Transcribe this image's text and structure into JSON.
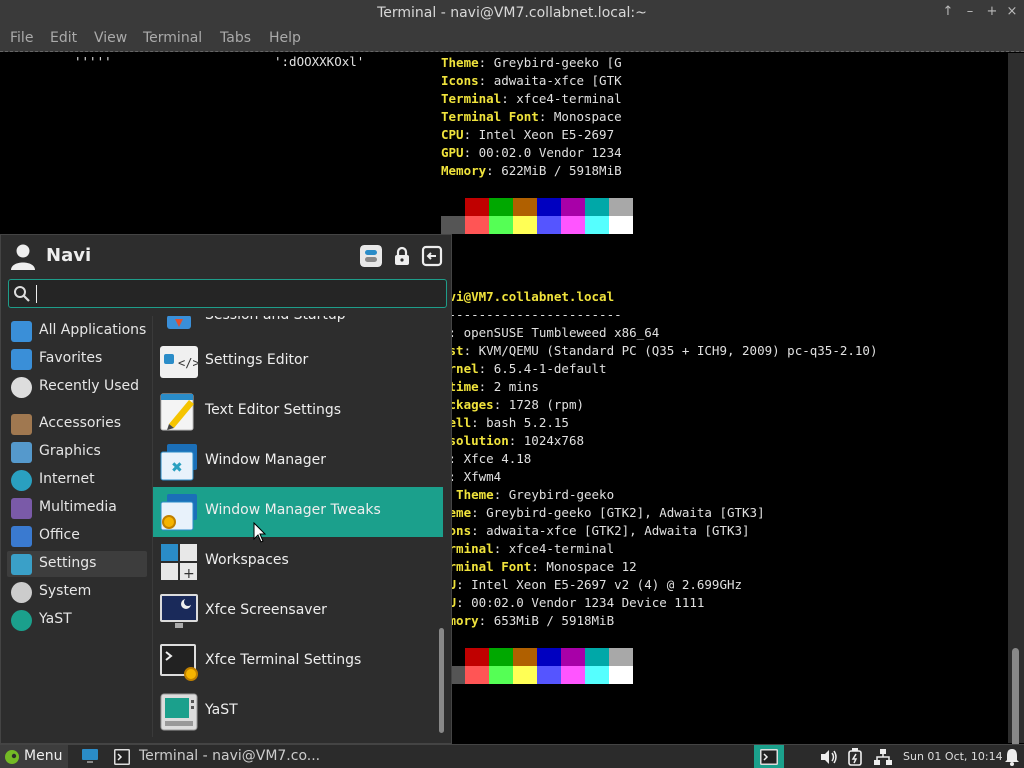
{
  "window": {
    "title": "Terminal - navi@VM7.collabnet.local:~",
    "controls": [
      "↑",
      "–",
      "+",
      "×"
    ]
  },
  "menubar": [
    "File",
    "Edit",
    "View",
    "Terminal",
    "Tabs",
    "Help"
  ],
  "terminal": {
    "top": {
      "logo_left": "'''''",
      "logo_right": "':dOOXXKOxl'",
      "rows": [
        {
          "k": "Theme",
          "v": ": Greybird-geeko [G"
        },
        {
          "k": "Icons",
          "v": ": adwaita-xfce [GTK"
        },
        {
          "k": "Terminal",
          "v": ": xfce4-terminal"
        },
        {
          "k": "Terminal Font",
          "v": ": Monospace"
        },
        {
          "k": "CPU",
          "v": ": Intel Xeon E5-2697"
        },
        {
          "k": "GPU",
          "v": ": 00:02.0 Vendor 1234"
        },
        {
          "k": "Memory",
          "v": ": 622MiB / 5918MiB"
        }
      ]
    },
    "bottom": {
      "user_host": "avi@VM7.collabnet.local",
      "divider": "------------------------",
      "rows": [
        {
          "k": "S",
          "v": ": openSUSE Tumbleweed x86_64"
        },
        {
          "k": "ost",
          "v": ": KVM/QEMU (Standard PC (Q35 + ICH9, 2009) pc-q35-2.10)"
        },
        {
          "k": "ernel",
          "v": ": 6.5.4-1-default"
        },
        {
          "k": "ptime",
          "v": ": 2 mins"
        },
        {
          "k": "ackages",
          "v": ": 1728 (rpm)"
        },
        {
          "k": "hell",
          "v": ": bash 5.2.15"
        },
        {
          "k": "esolution",
          "v": ": 1024x768"
        },
        {
          "k": "E",
          "v": ": Xfce 4.18"
        },
        {
          "k": "M",
          "v": ": Xfwm4"
        },
        {
          "k": "M Theme",
          "v": ": Greybird-geeko"
        },
        {
          "k": "heme",
          "v": ": Greybird-geeko [GTK2], Adwaita [GTK3]"
        },
        {
          "k": "cons",
          "v": ": adwaita-xfce [GTK2], Adwaita [GTK3]"
        },
        {
          "k": "erminal",
          "v": ": xfce4-terminal"
        },
        {
          "k": "erminal Font",
          "v": ": Monospace 12"
        },
        {
          "k": "PU",
          "v": ": Intel Xeon E5-2697 v2 (4) @ 2.699GHz"
        },
        {
          "k": "PU",
          "v": ": 00:02.0 Vendor 1234 Device 1111"
        },
        {
          "k": "emory",
          "v": ": 653MiB / 5918MiB"
        }
      ]
    },
    "palette_dark": [
      "#000000",
      "#c00000",
      "#00a800",
      "#b06000",
      "#0000c0",
      "#a800a8",
      "#00a8a8",
      "#a8a8a8"
    ],
    "palette_bright": [
      "#555555",
      "#ff5555",
      "#55ff55",
      "#ffff55",
      "#5555ff",
      "#ff55ff",
      "#55ffff",
      "#ffffff"
    ]
  },
  "whisker": {
    "user": "Navi",
    "search_placeholder": "",
    "categories": [
      {
        "label": "All Applications",
        "icon": "all-apps-icon"
      },
      {
        "label": "Favorites",
        "icon": "favorites-icon"
      },
      {
        "label": "Recently Used",
        "icon": "recently-used-icon"
      },
      {
        "label": "Accessories",
        "icon": "accessories-icon"
      },
      {
        "label": "Graphics",
        "icon": "graphics-icon"
      },
      {
        "label": "Internet",
        "icon": "internet-icon"
      },
      {
        "label": "Multimedia",
        "icon": "multimedia-icon"
      },
      {
        "label": "Office",
        "icon": "office-icon"
      },
      {
        "label": "Settings",
        "icon": "settings-icon"
      },
      {
        "label": "System",
        "icon": "system-icon"
      },
      {
        "label": "YaST",
        "icon": "yast-icon"
      }
    ],
    "active_category": "Settings",
    "apps": [
      {
        "label": "Session and Startup",
        "icon": "session-startup-icon"
      },
      {
        "label": "Settings Editor",
        "icon": "settings-editor-icon"
      },
      {
        "label": "Text Editor Settings",
        "icon": "text-editor-icon"
      },
      {
        "label": "Window Manager",
        "icon": "window-manager-icon"
      },
      {
        "label": "Window Manager Tweaks",
        "icon": "window-manager-tweaks-icon"
      },
      {
        "label": "Workspaces",
        "icon": "workspaces-icon"
      },
      {
        "label": "Xfce Screensaver",
        "icon": "screensaver-icon"
      },
      {
        "label": "Xfce Terminal Settings",
        "icon": "terminal-settings-icon"
      },
      {
        "label": "YaST",
        "icon": "yast-app-icon"
      }
    ],
    "highlighted_app": "Window Manager Tweaks"
  },
  "panel": {
    "menu_label": "Menu",
    "task_label": "Terminal - navi@VM7.co...",
    "clock": "Sun 01 Oct, 10:14"
  },
  "colors": {
    "accent": "#1ba08c",
    "term_key": "#f0e33c",
    "panel": "#2b2b2b"
  }
}
